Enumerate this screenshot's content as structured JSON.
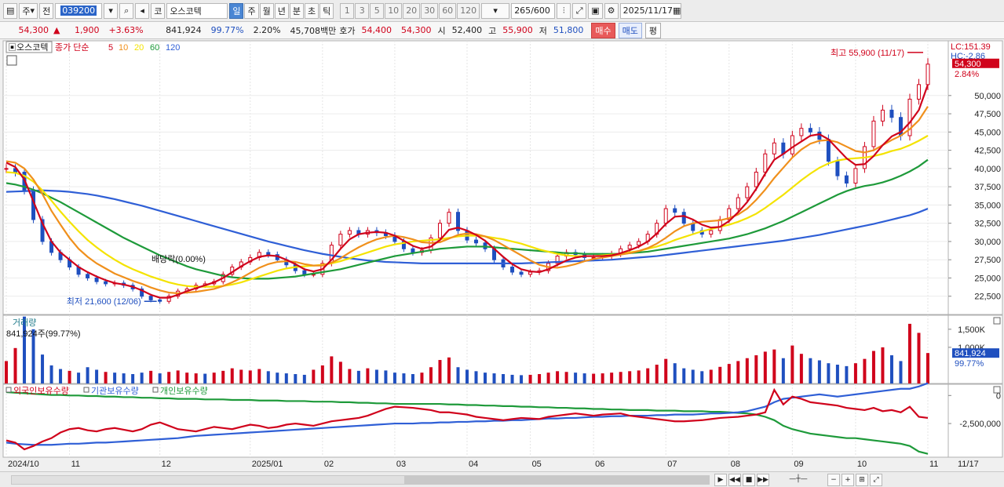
{
  "toolbar": {
    "period_type": "주",
    "prev_label": "전",
    "code": "039200",
    "market": "코",
    "name": "오스코텍",
    "tabs": [
      "일",
      "주",
      "월",
      "년",
      "분",
      "초",
      "틱"
    ],
    "active_tab": "일",
    "nums": [
      "1",
      "3",
      "5",
      "10",
      "20",
      "30",
      "60",
      "120"
    ],
    "count": "265",
    "count_total": "/600",
    "date": "2025/11/17"
  },
  "quote": {
    "price": "54,300",
    "arrow": "▲",
    "change": "1,900",
    "change_pct": "+3.63%",
    "volume": "841,924",
    "vol_ratio": "99.77%",
    "turnover_pct": "2.20%",
    "amount": "45,708백만",
    "hoga_label": "호가",
    "ask": "54,400",
    "bid": "54,300",
    "open_label": "시",
    "open": "52,400",
    "high_label": "고",
    "high": "55,900",
    "low_label": "저",
    "low": "51,800",
    "buy_label": "매수",
    "sell_label": "매도",
    "avg_label": "평"
  },
  "chart_data": {
    "type": "line",
    "title": "오스코텍",
    "ma_label": "종가 단순",
    "ma_periods": [
      "5",
      "10",
      "20",
      "60",
      "120"
    ],
    "ma_colors": [
      "#d0021b",
      "#f0901c",
      "#f4e300",
      "#1e9a3a",
      "#2f5fd6"
    ],
    "price_axis": [
      "50,000",
      "47,500",
      "45,000",
      "42,500",
      "40,000",
      "37,500",
      "35,000",
      "32,500",
      "30,000",
      "27,500",
      "25,000",
      "22,500"
    ],
    "ylim": [
      20000,
      57500
    ],
    "x_labels": [
      "2024/10",
      "11",
      "12",
      "2025/01",
      "02",
      "03",
      "04",
      "05",
      "06",
      "07",
      "08",
      "09",
      "10",
      "11"
    ],
    "last_date_label": "11/17",
    "max_annotation": "최고 55,900 (11/17)",
    "min_annotation": "최저 21,600 (12/06)",
    "dividend_annotation": "배당락(0.00%)",
    "lc_label": "LC:151.39",
    "hc_label": "HC:-2.86",
    "price_tag": "54,300",
    "price_tag_pct": "2.84%",
    "close": [
      40000,
      39500,
      37000,
      33000,
      30000,
      28500,
      27500,
      26500,
      25500,
      25000,
      24500,
      24200,
      24300,
      24000,
      23500,
      22500,
      22000,
      21800,
      22500,
      23200,
      23500,
      24000,
      24200,
      24500,
      25500,
      26500,
      27200,
      27800,
      28500,
      28200,
      27500,
      26800,
      26000,
      25500,
      25500,
      27000,
      29500,
      31000,
      31500,
      31000,
      31500,
      31200,
      30800,
      30000,
      29000,
      28500,
      28800,
      30500,
      32500,
      34000,
      31500,
      30200,
      29800,
      29000,
      27500,
      26500,
      25800,
      25500,
      25800,
      26000,
      27000,
      28000,
      28500,
      28200,
      27800,
      27800,
      28000,
      28300,
      29000,
      29500,
      30000,
      31000,
      32500,
      34500,
      34000,
      32500,
      31500,
      31000,
      31500,
      33000,
      34500,
      36000,
      37500,
      39500,
      42000,
      43500,
      42000,
      44500,
      45500,
      45000,
      44000,
      41000,
      39000,
      38000,
      40000,
      43000,
      46500,
      48000,
      47000,
      44500,
      49500,
      51500,
      54300
    ],
    "ma5": [
      40800,
      40200,
      38500,
      35500,
      32500,
      30000,
      28500,
      27500,
      26500,
      25800,
      25200,
      24700,
      24300,
      24100,
      23800,
      23300,
      22700,
      22300,
      22300,
      22700,
      23200,
      23600,
      24000,
      24400,
      25000,
      25800,
      26600,
      27300,
      27900,
      28100,
      28000,
      27500,
      26900,
      26200,
      25900,
      26200,
      27500,
      29000,
      30300,
      31000,
      31200,
      31300,
      31200,
      30800,
      30100,
      29400,
      29000,
      29300,
      30200,
      31600,
      31900,
      31500,
      30900,
      30100,
      29000,
      27900,
      26900,
      26200,
      25900,
      25800,
      26200,
      26800,
      27400,
      27800,
      28000,
      28000,
      28000,
      28100,
      28400,
      28800,
      29300,
      30000,
      31100,
      32400,
      33400,
      33500,
      33000,
      32300,
      31900,
      32000,
      32800,
      34000,
      35400,
      37200,
      39300,
      41200,
      42000,
      42900,
      43700,
      44500,
      44700,
      44000,
      42700,
      41400,
      40500,
      40600,
      41700,
      43200,
      44400,
      45000,
      46300,
      48000,
      51500
    ],
    "ma10": [
      41000,
      40800,
      40000,
      38500,
      36500,
      34200,
      32300,
      30500,
      29000,
      27900,
      27000,
      26300,
      25600,
      25100,
      24600,
      24200,
      23700,
      23300,
      23000,
      22900,
      23000,
      23100,
      23300,
      23500,
      23900,
      24400,
      25000,
      25700,
      26400,
      26900,
      27200,
      27300,
      27200,
      26900,
      26700,
      26700,
      27100,
      27700,
      28500,
      29200,
      29800,
      30300,
      30600,
      30800,
      30600,
      30300,
      29900,
      29800,
      29900,
      30400,
      30900,
      31100,
      31000,
      30700,
      30200,
      29500,
      28800,
      28100,
      27400,
      26800,
      26500,
      26400,
      26600,
      26900,
      27300,
      27600,
      27800,
      28000,
      28200,
      28400,
      28700,
      29100,
      29700,
      30500,
      31400,
      32100,
      32500,
      32700,
      32800,
      32900,
      33200,
      33700,
      34500,
      35700,
      37100,
      38700,
      40100,
      41500,
      42600,
      43400,
      43800,
      43900,
      43600,
      43000,
      42400,
      42200,
      42500,
      43200,
      43900,
      44500,
      45400,
      46600,
      48500
    ],
    "ma20": [
      39500,
      39400,
      39000,
      38200,
      37000,
      35600,
      34100,
      32700,
      31400,
      30200,
      29200,
      28300,
      27500,
      26800,
      26200,
      25700,
      25200,
      24800,
      24400,
      24100,
      23900,
      23800,
      23800,
      23800,
      23900,
      24100,
      24400,
      24800,
      25200,
      25600,
      26000,
      26300,
      26500,
      26600,
      26700,
      26800,
      27000,
      27300,
      27700,
      28100,
      28500,
      28900,
      29300,
      29600,
      29800,
      30000,
      30100,
      30200,
      30300,
      30500,
      30700,
      30800,
      30800,
      30700,
      30500,
      30300,
      30000,
      29700,
      29300,
      28900,
      28600,
      28300,
      28100,
      28000,
      28000,
      28000,
      28100,
      28200,
      28300,
      28500,
      28700,
      29000,
      29300,
      29700,
      30200,
      30600,
      31000,
      31400,
      31700,
      32000,
      32300,
      32700,
      33200,
      33800,
      34600,
      35500,
      36400,
      37400,
      38400,
      39300,
      40100,
      40700,
      41100,
      41300,
      41400,
      41500,
      41700,
      42000,
      42400,
      42700,
      43200,
      43800,
      44500
    ],
    "ma60": [
      38000,
      37800,
      37500,
      37100,
      36600,
      36000,
      35400,
      34700,
      34000,
      33300,
      32600,
      31900,
      31200,
      30500,
      29900,
      29300,
      28700,
      28100,
      27600,
      27100,
      26600,
      26200,
      25900,
      25600,
      25300,
      25100,
      25000,
      24900,
      24900,
      24900,
      25000,
      25100,
      25200,
      25400,
      25600,
      25800,
      26000,
      26200,
      26500,
      26800,
      27100,
      27400,
      27700,
      28000,
      28200,
      28400,
      28600,
      28800,
      29000,
      29100,
      29200,
      29300,
      29300,
      29300,
      29200,
      29100,
      29000,
      28900,
      28800,
      28700,
      28600,
      28500,
      28400,
      28400,
      28300,
      28300,
      28300,
      28300,
      28300,
      28400,
      28500,
      28600,
      28800,
      29000,
      29200,
      29400,
      29600,
      29800,
      30000,
      30200,
      30400,
      30700,
      31000,
      31400,
      31800,
      32300,
      32800,
      33400,
      34000,
      34600,
      35200,
      35800,
      36400,
      36900,
      37300,
      37600,
      37800,
      38100,
      38500,
      39000,
      39600,
      40300,
      41200
    ],
    "ma120": [
      36800,
      36850,
      36900,
      36950,
      37000,
      36950,
      36900,
      36800,
      36650,
      36500,
      36300,
      36050,
      35800,
      35500,
      35200,
      34900,
      34550,
      34200,
      33850,
      33500,
      33150,
      32800,
      32450,
      32100,
      31750,
      31400,
      31050,
      30700,
      30350,
      30000,
      29700,
      29400,
      29100,
      28800,
      28550,
      28300,
      28100,
      27900,
      27700,
      27550,
      27400,
      27300,
      27200,
      27150,
      27100,
      27050,
      27000,
      27000,
      27000,
      27000,
      27000,
      27000,
      27000,
      27000,
      27000,
      27000,
      27000,
      27000,
      27050,
      27100,
      27150,
      27200,
      27250,
      27300,
      27350,
      27400,
      27450,
      27500,
      27600,
      27700,
      27800,
      27900,
      28000,
      28150,
      28300,
      28450,
      28600,
      28750,
      28900,
      29050,
      29200,
      29350,
      29500,
      29650,
      29800,
      29950,
      30100,
      30300,
      30500,
      30700,
      30900,
      31150,
      31400,
      31650,
      31900,
      32150,
      32400,
      32700,
      33000,
      33300,
      33600,
      34000,
      34500
    ],
    "volume_label": "거래량",
    "volume_text": "841,924주(99.77%)",
    "volume_axis": [
      "1,500K",
      "1,000K"
    ],
    "volume_tag": "841,924",
    "volume_tag_pct": "99.77%",
    "volume_ylim": [
      0,
      1800000
    ],
    "volume": [
      620000,
      980000,
      1850000,
      1500000,
      800000,
      500000,
      400000,
      350000,
      300000,
      450000,
      380000,
      320000,
      300000,
      280000,
      260000,
      300000,
      350000,
      280000,
      320000,
      360000,
      300000,
      280000,
      270000,
      300000,
      350000,
      420000,
      380000,
      360000,
      400000,
      340000,
      300000,
      280000,
      260000,
      240000,
      380000,
      500000,
      750000,
      600000,
      400000,
      350000,
      420000,
      380000,
      360000,
      300000,
      280000,
      260000,
      300000,
      450000,
      650000,
      720000,
      450000,
      380000,
      340000,
      300000,
      280000,
      260000,
      240000,
      230000,
      240000,
      260000,
      300000,
      340000,
      320000,
      300000,
      280000,
      270000,
      280000,
      300000,
      320000,
      340000,
      360000,
      420000,
      520000,
      680000,
      560000,
      420000,
      380000,
      340000,
      380000,
      460000,
      540000,
      620000,
      700000,
      780000,
      880000,
      940000,
      700000,
      1050000,
      820000,
      700000,
      640000,
      560000,
      520000,
      480000,
      560000,
      680000,
      900000,
      1000000,
      780000,
      620000,
      1650000,
      1400000,
      841924
    ],
    "volume_up": [
      true,
      true,
      false,
      false,
      false,
      false,
      false,
      true,
      false,
      false,
      false,
      true,
      false,
      false,
      false,
      false,
      true,
      false,
      true,
      true,
      true,
      true,
      false,
      true,
      true,
      true,
      true,
      true,
      true,
      false,
      false,
      false,
      false,
      false,
      true,
      true,
      true,
      true,
      true,
      false,
      true,
      false,
      false,
      false,
      false,
      false,
      true,
      true,
      true,
      true,
      false,
      false,
      false,
      false,
      false,
      false,
      false,
      false,
      true,
      true,
      true,
      true,
      true,
      false,
      false,
      true,
      true,
      true,
      true,
      true,
      true,
      true,
      true,
      true,
      false,
      false,
      false,
      false,
      true,
      true,
      true,
      true,
      true,
      true,
      true,
      true,
      false,
      true,
      true,
      false,
      false,
      false,
      false,
      false,
      true,
      true,
      true,
      true,
      false,
      false,
      true,
      true,
      true
    ],
    "investor_labels": [
      "외국인보유수량",
      "기관보유수량",
      "개인보유수량"
    ],
    "investor_axis": [
      "0",
      "-2,500,000"
    ],
    "investor_ylim": [
      -5500000,
      1000000
    ],
    "investor_colors": [
      "#d0021b",
      "#2f5fd6",
      "#1e9a3a"
    ],
    "foreign": [
      -4000000,
      -4200000,
      -4800000,
      -4500000,
      -4100000,
      -3800000,
      -3300000,
      -3000000,
      -2900000,
      -3100000,
      -3200000,
      -3000000,
      -2900000,
      -3050000,
      -3200000,
      -3000000,
      -2600000,
      -2400000,
      -2700000,
      -3000000,
      -3100000,
      -3200000,
      -3000000,
      -2800000,
      -2900000,
      -3000000,
      -2800000,
      -2600000,
      -2700000,
      -2900000,
      -2800000,
      -2600000,
      -2500000,
      -2600000,
      -2700000,
      -2500000,
      -2300000,
      -2200000,
      -2100000,
      -2000000,
      -1800000,
      -1500000,
      -1200000,
      -1000000,
      -1050000,
      -1100000,
      -1200000,
      -1300000,
      -1500000,
      -1500000,
      -1600000,
      -1700000,
      -1900000,
      -2000000,
      -2100000,
      -2200000,
      -2100000,
      -2000000,
      -2050000,
      -2100000,
      -1900000,
      -1800000,
      -1700000,
      -1600000,
      -1700000,
      -1800000,
      -1700000,
      -1650000,
      -1600000,
      -1800000,
      -1900000,
      -2000000,
      -2100000,
      -2200000,
      -2300000,
      -2300000,
      -2250000,
      -2200000,
      -2100000,
      -2000000,
      -1950000,
      -1900000,
      -1800000,
      -1700000,
      -1500000,
      500000,
      -800000,
      -100000,
      -300000,
      -600000,
      -700000,
      -800000,
      -900000,
      -1100000,
      -1200000,
      -1300000,
      -1100000,
      -1400000,
      -1300000,
      -1500000,
      -1000000,
      -1900000,
      -2000000
    ],
    "institution": [
      -4200000,
      -4300000,
      -4350000,
      -4400000,
      -4400000,
      -4400000,
      -4350000,
      -4300000,
      -4300000,
      -4250000,
      -4200000,
      -4200000,
      -4150000,
      -4100000,
      -4050000,
      -4000000,
      -3950000,
      -3900000,
      -3850000,
      -3800000,
      -3700000,
      -3600000,
      -3550000,
      -3500000,
      -3450000,
      -3400000,
      -3350000,
      -3300000,
      -3250000,
      -3200000,
      -3150000,
      -3100000,
      -3050000,
      -3000000,
      -2950000,
      -2900000,
      -2850000,
      -2800000,
      -2750000,
      -2700000,
      -2650000,
      -2600000,
      -2550000,
      -2500000,
      -2500000,
      -2500000,
      -2450000,
      -2450000,
      -2400000,
      -2400000,
      -2350000,
      -2350000,
      -2300000,
      -2300000,
      -2250000,
      -2250000,
      -2200000,
      -2200000,
      -2150000,
      -2100000,
      -2050000,
      -2050000,
      -2000000,
      -2000000,
      -1950000,
      -1900000,
      -1900000,
      -1850000,
      -1850000,
      -1800000,
      -1800000,
      -1800000,
      -1750000,
      -1750000,
      -1700000,
      -1700000,
      -1700000,
      -1650000,
      -1600000,
      -1600000,
      -1550000,
      -1500000,
      -1400000,
      -1200000,
      -1000000,
      -600000,
      -300000,
      -200000,
      -100000,
      0,
      100000,
      0,
      -100000,
      0,
      100000,
      200000,
      300000,
      400000,
      500000,
      600000,
      600000,
      800000,
      1100000
    ],
    "individual": [
      300000,
      250000,
      200000,
      150000,
      100000,
      50000,
      50000,
      0,
      0,
      -50000,
      -50000,
      -100000,
      -100000,
      -150000,
      -150000,
      -200000,
      -200000,
      -250000,
      -250000,
      -300000,
      -300000,
      -300000,
      -350000,
      -350000,
      -350000,
      -400000,
      -400000,
      -400000,
      -450000,
      -450000,
      -450000,
      -500000,
      -500000,
      -500000,
      -550000,
      -550000,
      -550000,
      -600000,
      -600000,
      -650000,
      -650000,
      -700000,
      -700000,
      -750000,
      -750000,
      -750000,
      -750000,
      -750000,
      -750000,
      -800000,
      -800000,
      -850000,
      -850000,
      -900000,
      -900000,
      -950000,
      -950000,
      -1000000,
      -1000000,
      -1050000,
      -1050000,
      -1100000,
      -1100000,
      -1150000,
      -1150000,
      -1200000,
      -1200000,
      -1250000,
      -1250000,
      -1300000,
      -1300000,
      -1300000,
      -1350000,
      -1350000,
      -1350000,
      -1400000,
      -1400000,
      -1400000,
      -1450000,
      -1450000,
      -1500000,
      -1550000,
      -1600000,
      -1700000,
      -1900000,
      -2200000,
      -2700000,
      -3000000,
      -3200000,
      -3400000,
      -3500000,
      -3600000,
      -3700000,
      -3800000,
      -3800000,
      -3900000,
      -4000000,
      -4100000,
      -4200000,
      -4300000,
      -4500000,
      -5000000,
      -5200000
    ]
  }
}
